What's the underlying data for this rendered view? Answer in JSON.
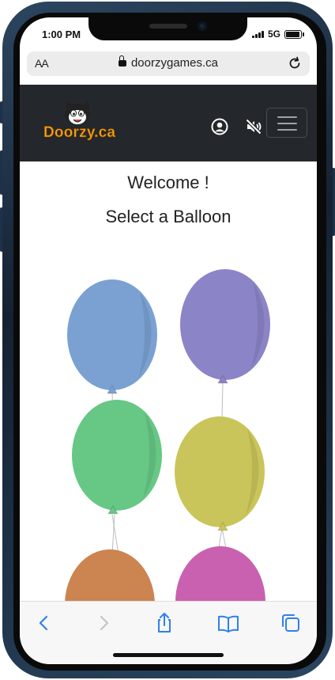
{
  "status_bar": {
    "time": "1:00 PM",
    "network": "5G"
  },
  "browser": {
    "text_size_label": "AA",
    "url": "doorzygames.ca"
  },
  "site": {
    "logo_text": "Doorzy.ca"
  },
  "main": {
    "welcome": "Welcome !",
    "prompt": "Select a Balloon"
  },
  "balloons": [
    {
      "color": "#7aa1d2",
      "name": "blue"
    },
    {
      "color": "#8b84c7",
      "name": "purple"
    },
    {
      "color": "#67c785",
      "name": "green"
    },
    {
      "color": "#c9c55a",
      "name": "yellow"
    },
    {
      "color": "#cc8450",
      "name": "orange"
    },
    {
      "color": "#c961b0",
      "name": "magenta"
    }
  ],
  "colors": {
    "navbar": "#24272b",
    "logo": "#f0a31a",
    "toolbar_icon": "#2f80ed"
  }
}
